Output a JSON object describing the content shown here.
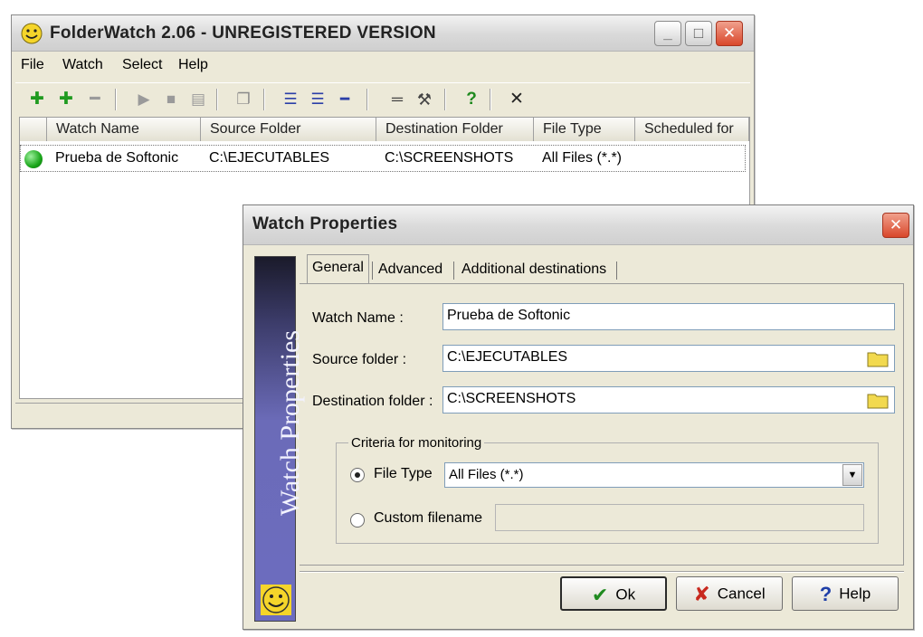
{
  "main_window": {
    "title": "FolderWatch 2.06 - UNREGISTERED VERSION",
    "menu": [
      "File",
      "Watch",
      "Select",
      "Help"
    ],
    "toolbar_icons": [
      "add-watch-icon",
      "add-multiple-icon",
      "remove-icon",
      "play-icon",
      "stop-icon",
      "properties-icon",
      "copy-icon",
      "view-details-icon",
      "view-list-icon",
      "view-small-icon",
      "options-icon",
      "tools-icon",
      "help-icon",
      "close-icon"
    ],
    "toolbar_glyphs": {
      "help": "?",
      "close": "✕"
    },
    "columns": [
      "Watch Name",
      "Source Folder",
      "Destination Folder",
      "File Type",
      "Scheduled for"
    ],
    "rows": [
      {
        "status_color": "#1aa61a",
        "watch_name": "Prueba de Softonic",
        "source": "C:\\EJECUTABLES",
        "destination": "C:\\SCREENSHOTS",
        "file_type": "All Files (*.*)",
        "scheduled": ""
      }
    ]
  },
  "dialog": {
    "title": "Watch Properties",
    "banner_text": "Watch Properties",
    "tabs": [
      {
        "label": "General",
        "active": true
      },
      {
        "label": "Advanced",
        "active": false
      },
      {
        "label": "Additional destinations",
        "active": false
      }
    ],
    "watch_name": {
      "label": "Watch Name :",
      "value": "Prueba de Softonic"
    },
    "source_folder": {
      "label": "Source folder :",
      "value": "C:\\EJECUTABLES"
    },
    "destination_folder": {
      "label": "Destination folder :",
      "value": "C:\\SCREENSHOTS"
    },
    "criteria": {
      "legend": "Criteria for monitoring",
      "file_type_label": "File Type",
      "file_type_value": "All Files (*.*)",
      "file_type_selected": true,
      "custom_label": "Custom filename",
      "custom_value": ""
    },
    "buttons": {
      "ok": "Ok",
      "cancel": "Cancel",
      "help": "Help"
    }
  },
  "colors": {
    "ok_check": "#1f8a1f",
    "cancel_x": "#c8281e",
    "help_q": "#1f3fa8",
    "folder": "#f2d94e"
  }
}
